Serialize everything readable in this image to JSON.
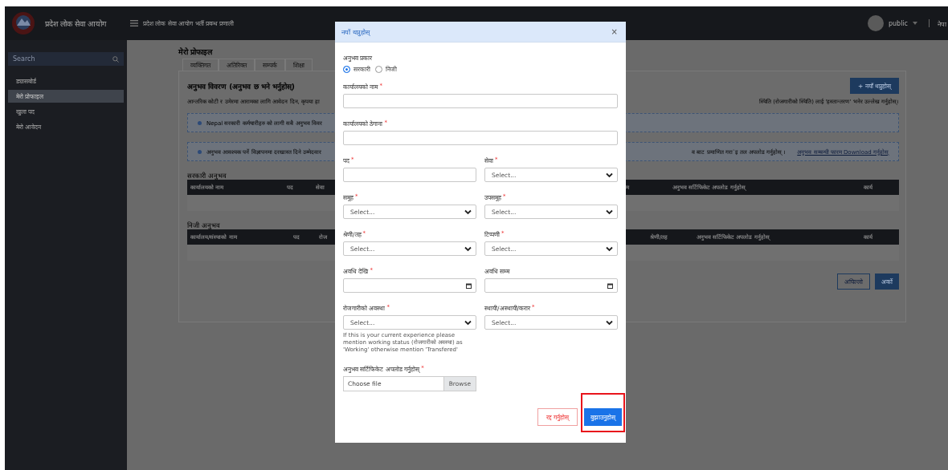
{
  "navbar": {
    "org_name": "प्रदेश लोक सेवा आयोग",
    "system_title": "प्रदेश लोक सेवा आयोग भर्ती प्रबन्ध प्रणाली",
    "user": "public",
    "language": "नेपा"
  },
  "sidebar": {
    "search": {
      "placeholder": "Search"
    },
    "items": [
      {
        "label": "ड्यासबोर्ड",
        "selected": false
      },
      {
        "label": "मेरो प्रोफाइल",
        "selected": true
      },
      {
        "label": "खुला पद",
        "selected": false
      },
      {
        "label": "मेरो आवेदन",
        "selected": false
      }
    ]
  },
  "page": {
    "title": "मेरो प्रोफाइल",
    "tabs": [
      {
        "label": "व्यक्तिगत",
        "selected": false
      },
      {
        "label": "अतिरिक्त",
        "selected": false
      },
      {
        "label": "सम्पर्क",
        "selected": false
      },
      {
        "label": "शिक्षा",
        "selected": false
      }
    ],
    "section_title": "अनुभव विवरण (अनुभव छ भने भर्नुहोस्)",
    "add_button": "+ नयाँ थप्नुहोस्",
    "description_fragments": [
      "आन्तरिक कोटी र उमेरमा आरामका लागि आवेदन दिन, कृपया हा",
      "स्थिति (रोजगारीको स्थिति) लाई 'हस्तान्तरण' भनेर उल्लेख गर्नुहोस्।"
    ],
    "alerts": [
      {
        "fragments": [
          "Nepal सरकारी कर्मचारीहरु को लागी सबै अनुभव विवर"
        ]
      },
      {
        "fragments": [
          "अनुभव आवश्यक पर्ने विज्ञापनमा दरखास्त दिने उम्मेदवार",
          "व बाट प्रमाणित गरा`इ तल अपलोड गर्नुहोस् ।"
        ],
        "link": "अनुभव सम्बन्धी फारम Download गर्नुहोस्"
      }
    ],
    "tables": [
      {
        "title": "सरकारी अनुभव",
        "columns": [
          "कार्यालयको नाम",
          "पद",
          "सेवा",
          "म",
          "अनुभव सर्टिफिकेट अपलोड गर्नुहोस्",
          "कार्य"
        ]
      },
      {
        "title": "निजी अनुभव",
        "columns": [
          "कार्यालय/संस्थाको नाम",
          "पद",
          "रोज",
          "श्रेणी/तह",
          "अनुभव सर्टिफिकेट अपलोड गर्नुहोस्",
          "कार्य"
        ]
      }
    ],
    "nav_buttons": [
      "अघिल्लो",
      "अर्को"
    ]
  },
  "modal": {
    "title": "नयाँ थप्नुहोस्",
    "close": "×",
    "experience_type": {
      "label": "अनुभव प्रकार",
      "options": [
        {
          "label": "सरकारी",
          "selected": true
        },
        {
          "label": "निजी",
          "selected": false
        }
      ]
    },
    "rows": [
      [
        {
          "kind": "text",
          "label": "कार्यालयको नाम",
          "required_mark": "*"
        }
      ],
      [
        {
          "kind": "text",
          "label": "कार्यालयको ठेगाना",
          "required_mark": "*"
        }
      ],
      [
        {
          "kind": "text",
          "label": "पद",
          "required_mark": "*"
        },
        {
          "kind": "select",
          "label": "सेवा",
          "required_mark": "*",
          "placeholder": "Select..."
        }
      ],
      [
        {
          "kind": "select",
          "label": "समूह",
          "required_mark": "*",
          "placeholder": "Select..."
        },
        {
          "kind": "select",
          "label": "उपसमूह",
          "required_mark": "*",
          "placeholder": "Select..."
        }
      ],
      [
        {
          "kind": "select",
          "label": "श्रेणी/तह",
          "required_mark": "*",
          "placeholder": "Select..."
        },
        {
          "kind": "select",
          "label": "टिप्पणी",
          "required_mark": "*",
          "placeholder": "Select..."
        }
      ],
      [
        {
          "kind": "date",
          "label": "अवधि देखि",
          "required_mark": "*"
        },
        {
          "kind": "date",
          "label": "अवधि सम्म"
        }
      ],
      [
        {
          "kind": "select",
          "label": "रोजगारीको अवस्था",
          "required_mark": "*",
          "placeholder": "Select...",
          "help": "If this is your current experience please mention working status (रोजगारीको अवस्था) as 'Working' otherwise mention 'Transfered'"
        },
        {
          "kind": "select",
          "label": "स्थायी/अस्थायी/करार",
          "required_mark": "*",
          "placeholder": "Select..."
        }
      ],
      [
        {
          "kind": "file",
          "label": "अनुभव सर्टिफिकेट अपलोड गर्नुहोस्",
          "required_mark": "*",
          "placeholder": "Choose file",
          "button": "Browse"
        }
      ]
    ],
    "buttons": [
      {
        "kind": "cancel",
        "label": "रद्द गर्नुहोस्",
        "highlighted": false
      },
      {
        "kind": "submit",
        "label": "बुझाउनुहोस्",
        "highlighted": true
      }
    ]
  }
}
